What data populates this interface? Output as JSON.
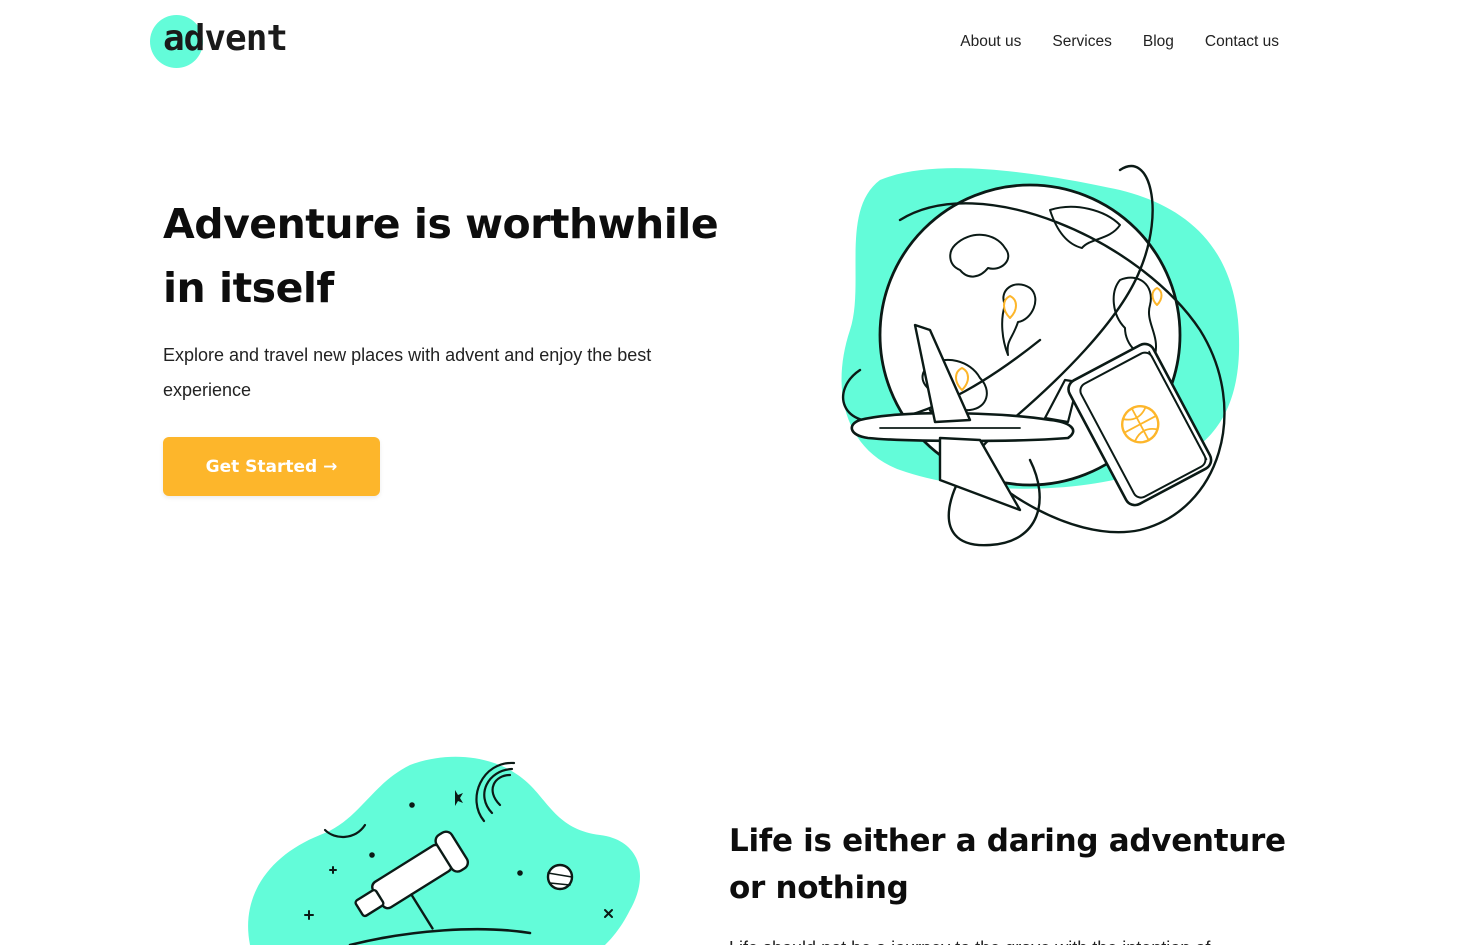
{
  "brand": {
    "name": "advent",
    "accent": "#63fcd9",
    "cta_color": "#fdb62b",
    "pin_color": "#fdb62b"
  },
  "nav": {
    "items": [
      "About us",
      "Services",
      "Blog",
      "Contact us"
    ]
  },
  "hero": {
    "title": "Adventure is worthwhile in itself",
    "description": "Explore and travel new places with advent and enjoy the best experience",
    "cta_label": "Get Started →",
    "illustration_icon": "globe-travel-illustration"
  },
  "section2": {
    "title": "Life is either a daring adventure or nothing",
    "text": "Life should not be a journey to the grave with the intention of",
    "illustration_icon": "space-telescope-illustration"
  }
}
